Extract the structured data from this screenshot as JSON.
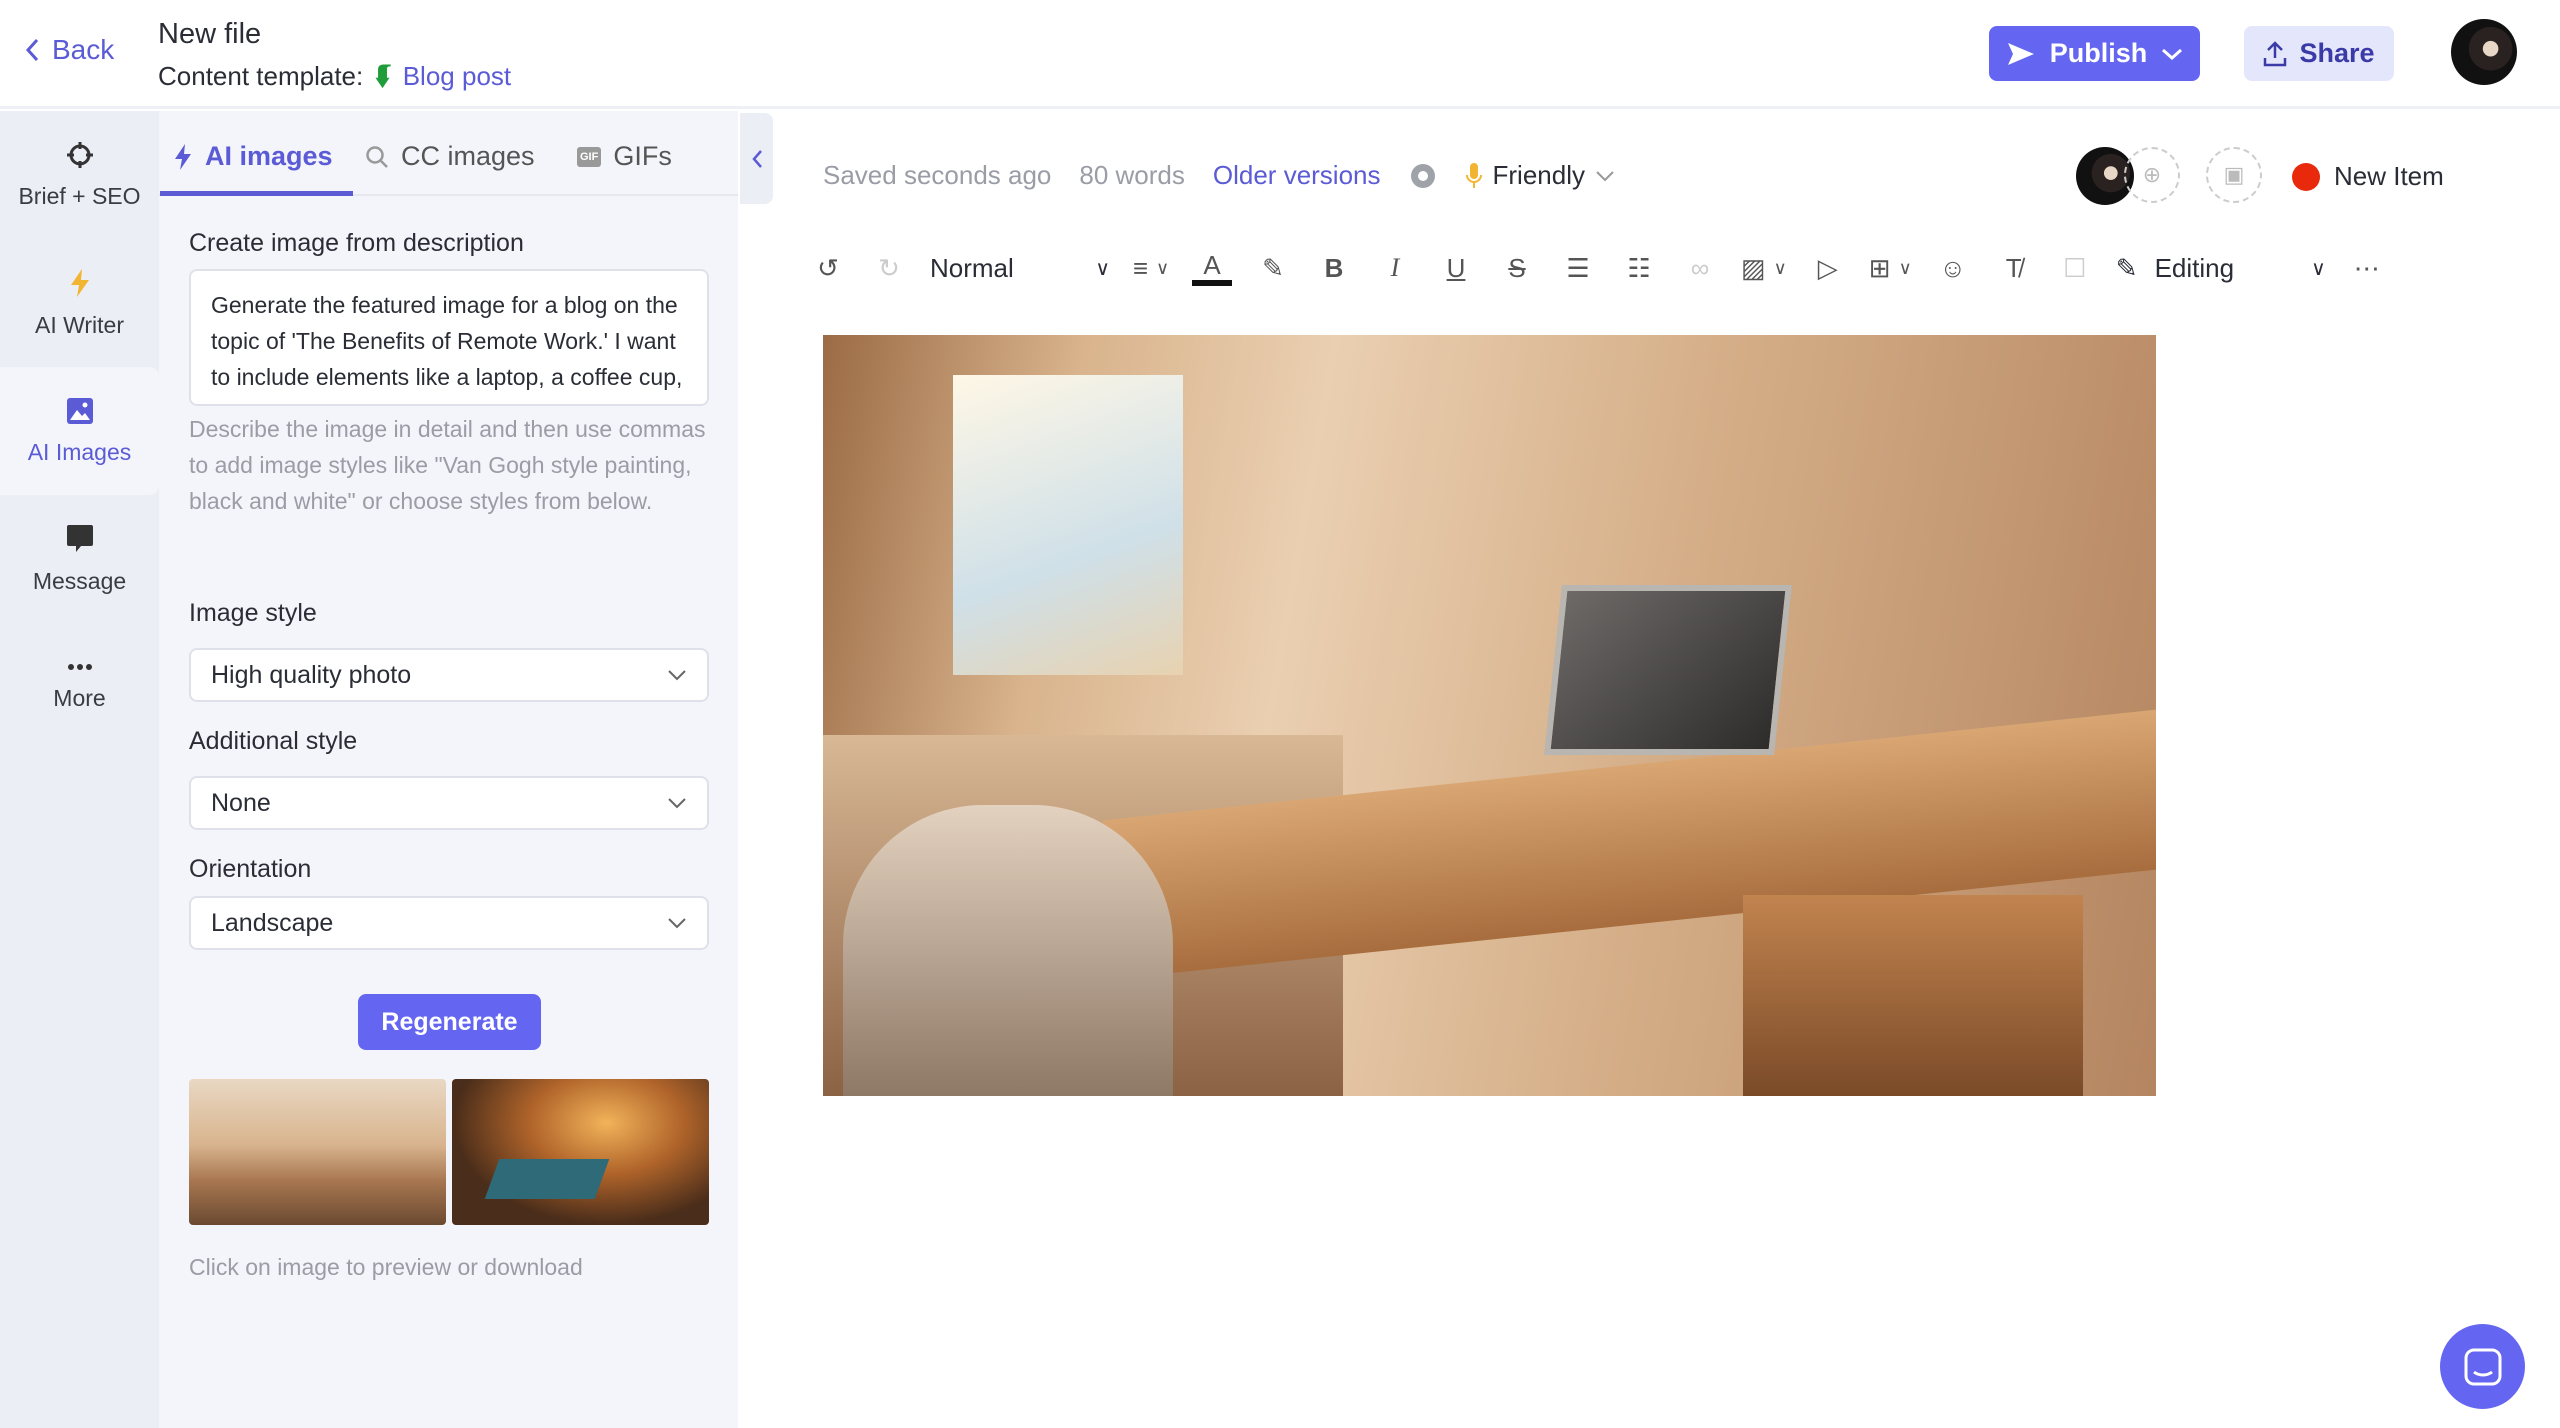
{
  "header": {
    "back_label": "Back",
    "title": "New file",
    "template_label": "Content template:",
    "template_name": "Blog post",
    "publish_label": "Publish",
    "share_label": "Share"
  },
  "rail": {
    "items": [
      {
        "label": "Brief + SEO",
        "icon": "crosshair-icon"
      },
      {
        "label": "AI Writer",
        "icon": "lightning-icon"
      },
      {
        "label": "AI Images",
        "icon": "image-icon",
        "active": true
      },
      {
        "label": "Message",
        "icon": "message-icon"
      },
      {
        "label": "More",
        "icon": "more-icon"
      }
    ]
  },
  "panel": {
    "tabs": [
      {
        "label": "AI images",
        "active": true
      },
      {
        "label": "CC images"
      },
      {
        "label": "GIFs"
      }
    ],
    "description_label": "Create image from description",
    "description_value": "Generate the featured image for a blog on the topic of 'The Benefits of Remote Work.' I want to include elements like a laptop, a coffee cup, and a home office setting.",
    "help_text": "Describe the image in detail and then use commas to add image styles like \"Van Gogh style painting, black and white\" or choose styles from below.",
    "image_style_label": "Image style",
    "image_style_value": "High quality photo",
    "additional_style_label": "Additional style",
    "additional_style_value": "None",
    "orientation_label": "Orientation",
    "orientation_value": "Landscape",
    "regenerate_label": "Regenerate",
    "caption": "Click on image to preview or download"
  },
  "editor": {
    "saved": "Saved seconds ago",
    "words": "80 words",
    "older_versions": "Older versions",
    "tone": "Friendly",
    "new_item": "New Item",
    "style_select": "Normal",
    "mode": "Editing"
  },
  "colors": {
    "accent": "#6466f1",
    "status_dot": "#e8290b",
    "template_icon": "#1f9d3a"
  }
}
